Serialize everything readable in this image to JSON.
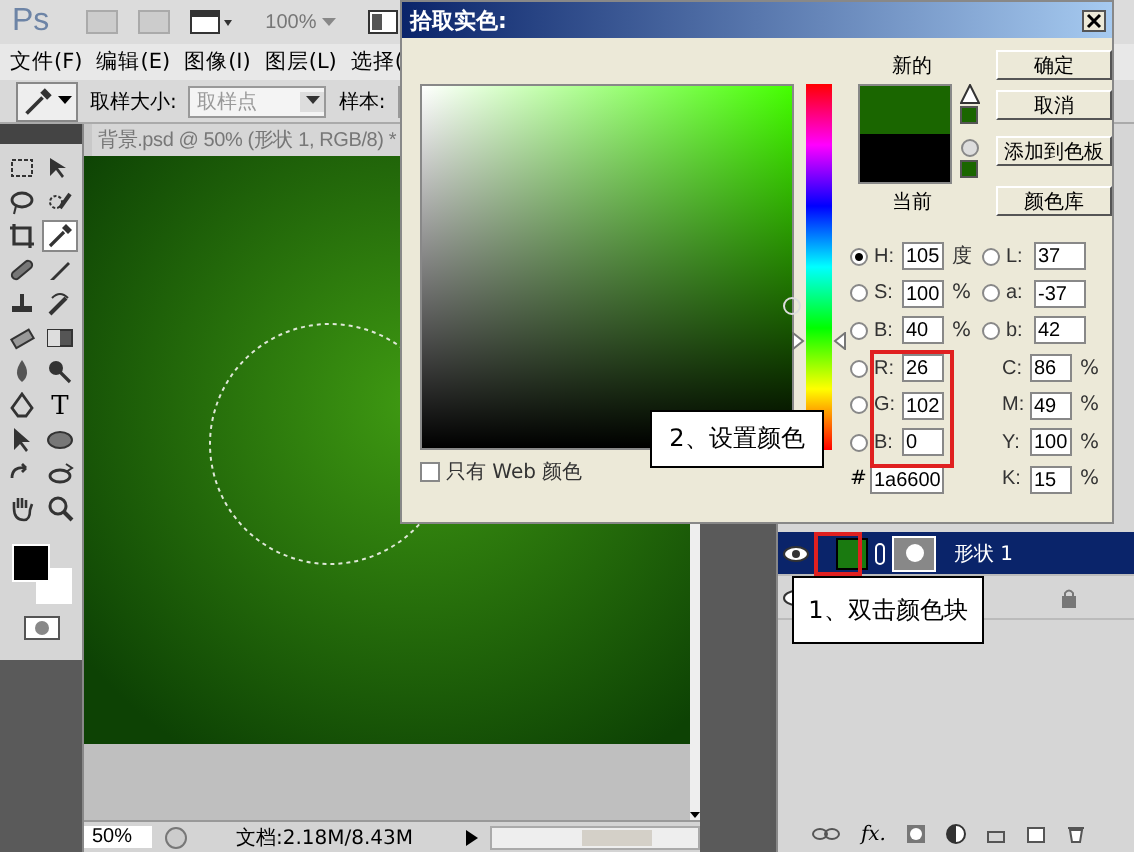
{
  "app_bar": {
    "logo": "Ps",
    "zoom": "100%"
  },
  "menu": [
    "文件(F)",
    "编辑(E)",
    "图像(I)",
    "图层(L)",
    "选择("
  ],
  "options_bar": {
    "sample_size_label": "取样大小:",
    "sample_size_value": "取样点",
    "sample_label": "样本:"
  },
  "tools": [
    {
      "kind": "marquee",
      "selected": false
    },
    {
      "kind": "move",
      "selected": false
    },
    {
      "kind": "lasso",
      "selected": false
    },
    {
      "kind": "quick-select",
      "selected": false
    },
    {
      "kind": "crop",
      "selected": false
    },
    {
      "kind": "eyedropper",
      "selected": true
    },
    {
      "kind": "bandage",
      "selected": false
    },
    {
      "kind": "brush",
      "selected": false
    },
    {
      "kind": "stamp",
      "selected": false
    },
    {
      "kind": "history-brush",
      "selected": false
    },
    {
      "kind": "eraser",
      "selected": false
    },
    {
      "kind": "gradient",
      "selected": false
    },
    {
      "kind": "drop",
      "selected": false
    },
    {
      "kind": "dodge",
      "selected": false
    },
    {
      "kind": "pen",
      "selected": false
    },
    {
      "kind": "type",
      "glyph": "T",
      "selected": false
    },
    {
      "kind": "arrow",
      "selected": false
    },
    {
      "kind": "ellipse",
      "selected": false
    },
    {
      "kind": "rotate",
      "selected": false
    },
    {
      "kind": "orbit",
      "selected": false
    },
    {
      "kind": "hand",
      "selected": false
    },
    {
      "kind": "magnifier",
      "selected": false
    }
  ],
  "document": {
    "tab_title": "背景.psd @ 50% (形状 1, RGB/8) *",
    "zoom": "50%",
    "info": "文档:2.18M/8.43M"
  },
  "color_picker": {
    "title": "拾取实色:",
    "hue_slider": {
      "level": 0.29
    },
    "new_label": "新的",
    "current_label": "当前",
    "buttons": [
      "确定",
      "取消",
      "添加到色板",
      "颜色库"
    ],
    "left_fields": [
      {
        "kind": "radio",
        "label": "H:",
        "value": "105",
        "unit": "度",
        "selected": true
      },
      {
        "kind": "radio",
        "label": "S:",
        "value": "100",
        "unit": "%",
        "selected": false
      },
      {
        "kind": "radio",
        "label": "B:",
        "value": "40",
        "unit": "%",
        "selected": false
      },
      {
        "kind": "radio",
        "label": "R:",
        "value": "26",
        "selected": false
      },
      {
        "kind": "radio",
        "label": "G:",
        "value": "102",
        "selected": false
      },
      {
        "kind": "radio",
        "label": "B:",
        "value": "0",
        "selected": false
      }
    ],
    "right_fields": [
      {
        "kind": "radio",
        "label": "L:",
        "value": "37",
        "selected": false
      },
      {
        "kind": "radio",
        "label": "a:",
        "value": "-37",
        "selected": false
      },
      {
        "kind": "radio",
        "label": "b:",
        "value": "42",
        "selected": false
      },
      {
        "kind": "plain",
        "label": "C:",
        "value": "86",
        "unit": "%"
      },
      {
        "kind": "plain",
        "label": "M:",
        "value": "49",
        "unit": "%"
      },
      {
        "kind": "plain",
        "label": "Y:",
        "value": "100",
        "unit": "%"
      },
      {
        "kind": "plain",
        "label": "K:",
        "value": "15",
        "unit": "%"
      }
    ],
    "hex": {
      "label": "#",
      "value": "1a6600"
    },
    "web_only": {
      "label": "只有 Web 颜色",
      "checked": false
    }
  },
  "layers": [
    {
      "name": "形状 1",
      "selected": true,
      "locked": false
    },
    {
      "selected": false,
      "locked": true
    }
  ],
  "layers_footer": {
    "fx": "fx."
  },
  "callouts": [
    "2、设置颜色",
    "1、双击颜色块"
  ]
}
